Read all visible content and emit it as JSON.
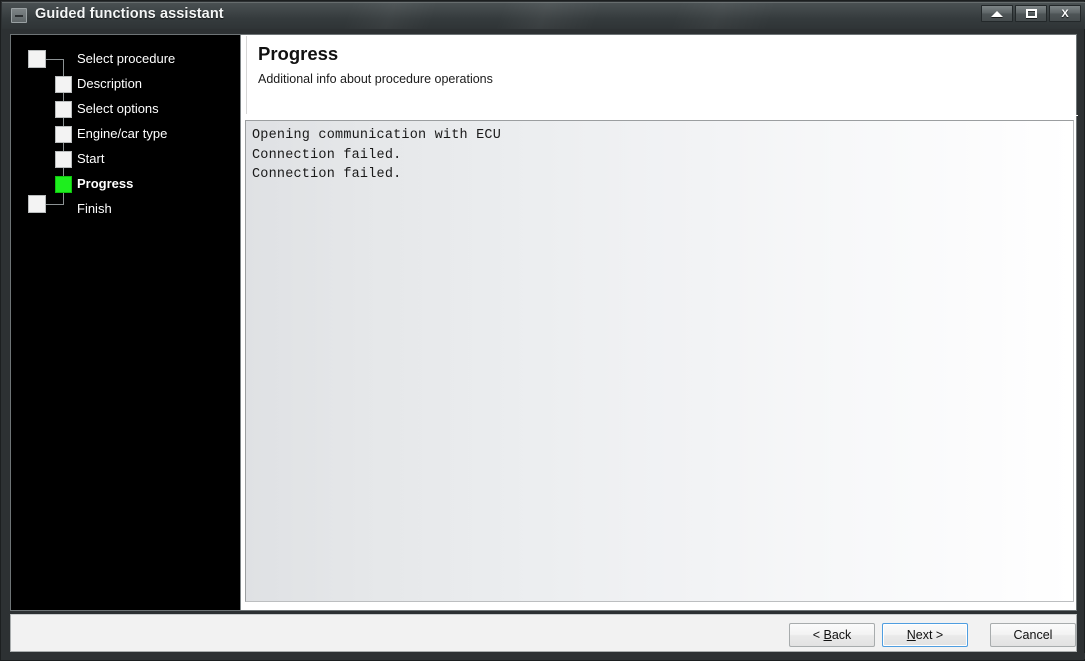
{
  "window": {
    "title": "Guided functions assistant",
    "icon": "collapse-square-icon",
    "controls": {
      "minimize": "minimize",
      "maximize": "restore",
      "close": "X"
    }
  },
  "sidebar": {
    "steps": [
      {
        "label": "Select procedure",
        "state": "pending",
        "level": 0
      },
      {
        "label": "Description",
        "state": "pending",
        "level": 1
      },
      {
        "label": "Select options",
        "state": "pending",
        "level": 1
      },
      {
        "label": "Engine/car type",
        "state": "pending",
        "level": 1
      },
      {
        "label": "Start",
        "state": "pending",
        "level": 1
      },
      {
        "label": "Progress",
        "state": "active",
        "level": 1
      },
      {
        "label": "Finish",
        "state": "pending",
        "level": 0
      }
    ],
    "active_color": "#1eee1e",
    "background": "#000000",
    "text_color": "#ffffff"
  },
  "header": {
    "title": "Progress",
    "subtitle": "Additional info about procedure operations"
  },
  "log": {
    "lines": [
      "Opening communication with ECU",
      "Connection failed.",
      "Connection failed."
    ]
  },
  "footer": {
    "back_label": "< Back",
    "back_mnemonic": "B",
    "next_label": "Next >",
    "next_mnemonic": "N",
    "cancel_label": "Cancel",
    "focused_button": "next"
  }
}
